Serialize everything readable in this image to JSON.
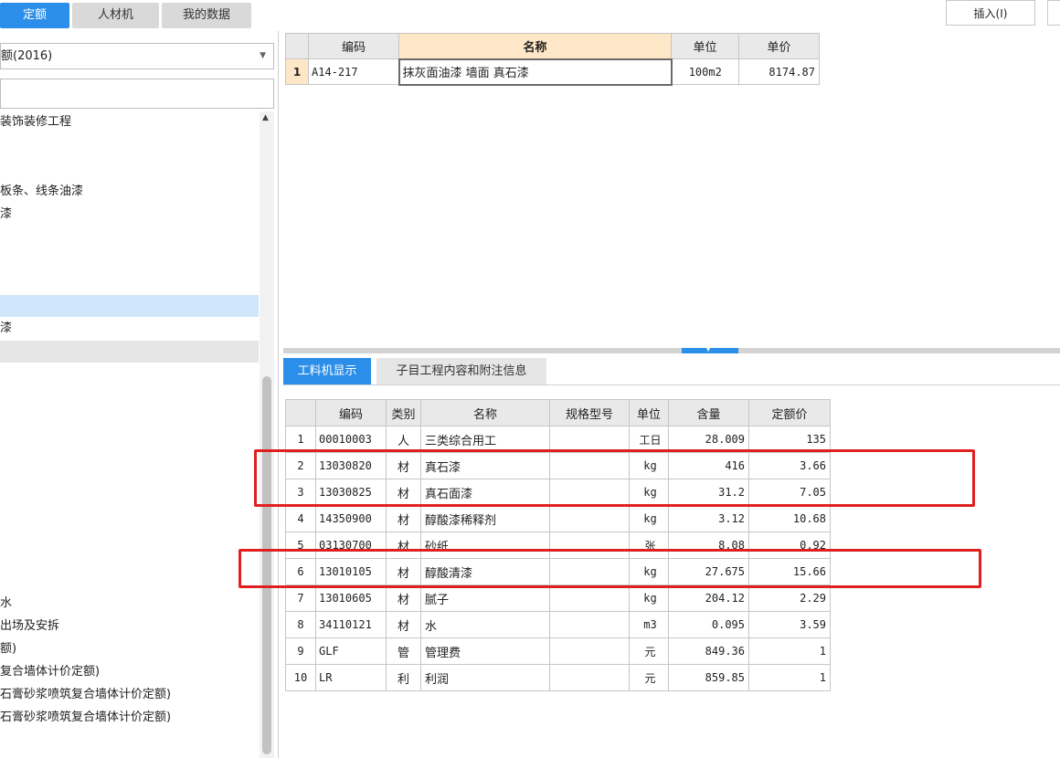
{
  "top_tabs": [
    {
      "label": "定额"
    },
    {
      "label": "人材机"
    },
    {
      "label": "我的数据"
    }
  ],
  "toolbar": {
    "insert_label": "插入(I)"
  },
  "left_panel": {
    "library_select": "额(2016)",
    "search_value": "",
    "tree_items": [
      "装饰装修工程",
      "板条、线条油漆",
      "漆",
      "漆",
      "水",
      "出场及安拆",
      "额)",
      "复合墙体计价定额)",
      "石膏砂浆喷筑复合墙体计价定额)",
      "石膏砂浆喷筑复合墙体计价定额)"
    ]
  },
  "top_grid": {
    "headers": {
      "code": "编码",
      "name": "名称",
      "unit": "单位",
      "price": "单价"
    },
    "rows": [
      {
        "no": "1",
        "code": "A14-217",
        "name": "抹灰面油漆 墙面 真石漆",
        "unit": "100m2",
        "price": "8174.87"
      }
    ]
  },
  "bottom_tabs": [
    {
      "label": "工料机显示"
    },
    {
      "label": "子目工程内容和附注信息"
    }
  ],
  "bottom_grid": {
    "headers": {
      "code": "编码",
      "type": "类别",
      "name": "名称",
      "spec": "规格型号",
      "unit": "单位",
      "qty": "含量",
      "price": "定额价"
    },
    "rows": [
      {
        "no": "1",
        "code": "00010003",
        "type": "人",
        "name": "三类综合用工",
        "spec": "",
        "unit": "工日",
        "qty": "28.009",
        "price": "135"
      },
      {
        "no": "2",
        "code": "13030820",
        "type": "材",
        "name": "真石漆",
        "spec": "",
        "unit": "kg",
        "qty": "416",
        "price": "3.66"
      },
      {
        "no": "3",
        "code": "13030825",
        "type": "材",
        "name": "真石面漆",
        "spec": "",
        "unit": "kg",
        "qty": "31.2",
        "price": "7.05"
      },
      {
        "no": "4",
        "code": "14350900",
        "type": "材",
        "name": "醇酸漆稀释剂",
        "spec": "",
        "unit": "kg",
        "qty": "3.12",
        "price": "10.68"
      },
      {
        "no": "5",
        "code": "03130700",
        "type": "材",
        "name": "砂纸",
        "spec": "",
        "unit": "张",
        "qty": "8.08",
        "price": "0.92"
      },
      {
        "no": "6",
        "code": "13010105",
        "type": "材",
        "name": "醇酸清漆",
        "spec": "",
        "unit": "kg",
        "qty": "27.675",
        "price": "15.66"
      },
      {
        "no": "7",
        "code": "13010605",
        "type": "材",
        "name": "腻子",
        "spec": "",
        "unit": "kg",
        "qty": "204.12",
        "price": "2.29"
      },
      {
        "no": "8",
        "code": "34110121",
        "type": "材",
        "name": "水",
        "spec": "",
        "unit": "m3",
        "qty": "0.095",
        "price": "3.59"
      },
      {
        "no": "9",
        "code": "GLF",
        "type": "管",
        "name": "管理费",
        "spec": "",
        "unit": "元",
        "qty": "849.36",
        "price": "1"
      },
      {
        "no": "10",
        "code": "LR",
        "type": "利",
        "name": "利润",
        "spec": "",
        "unit": "元",
        "qty": "859.85",
        "price": "1"
      }
    ]
  },
  "colors": {
    "accent": "#2b8ee8",
    "highlight": "#e02020",
    "selected_row": "#cfe6fb",
    "header_accent": "#fde7c6"
  }
}
